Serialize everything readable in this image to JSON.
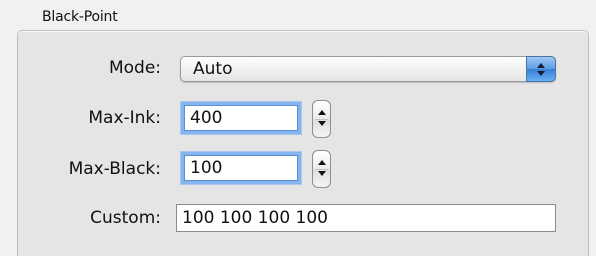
{
  "group": {
    "title": "Black-Point"
  },
  "mode": {
    "label": "Mode:",
    "selected": "Auto"
  },
  "max_ink": {
    "label": "Max-Ink:",
    "value": "400"
  },
  "max_black": {
    "label": "Max-Black:",
    "value": "100"
  },
  "custom": {
    "label": "Custom:",
    "value": "100 100 100 100"
  },
  "colors": {
    "focus_ring": "#86b4ee",
    "popup_stepper": "#3a7ed6",
    "panel_bg": "#e5e5e5"
  },
  "icons": {
    "popup_arrows": "up-down-chevron-icon",
    "stepper_arrows": "stepper-arrows-icon"
  }
}
